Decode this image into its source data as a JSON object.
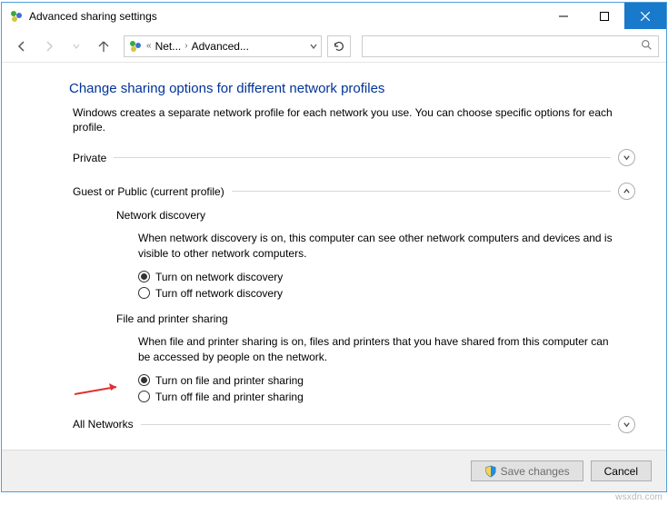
{
  "window": {
    "title": "Advanced sharing settings"
  },
  "breadcrumb": {
    "p1": "Net...",
    "p2": "Advanced..."
  },
  "page": {
    "title": "Change sharing options for different network profiles",
    "desc": "Windows creates a separate network profile for each network you use. You can choose specific options for each profile."
  },
  "sections": {
    "private": {
      "label": "Private"
    },
    "guest": {
      "label": "Guest or Public (current profile)",
      "nd": {
        "title": "Network discovery",
        "desc": "When network discovery is on, this computer can see other network computers and devices and is visible to other network computers.",
        "r1": "Turn on network discovery",
        "r2": "Turn off network discovery"
      },
      "fp": {
        "title": "File and printer sharing",
        "desc": "When file and printer sharing is on, files and printers that you have shared from this computer can be accessed by people on the network.",
        "r1": "Turn on file and printer sharing",
        "r2": "Turn off file and printer sharing"
      }
    },
    "all": {
      "label": "All Networks"
    }
  },
  "footer": {
    "save": "Save changes",
    "cancel": "Cancel"
  },
  "watermark": "wsxdn.com"
}
